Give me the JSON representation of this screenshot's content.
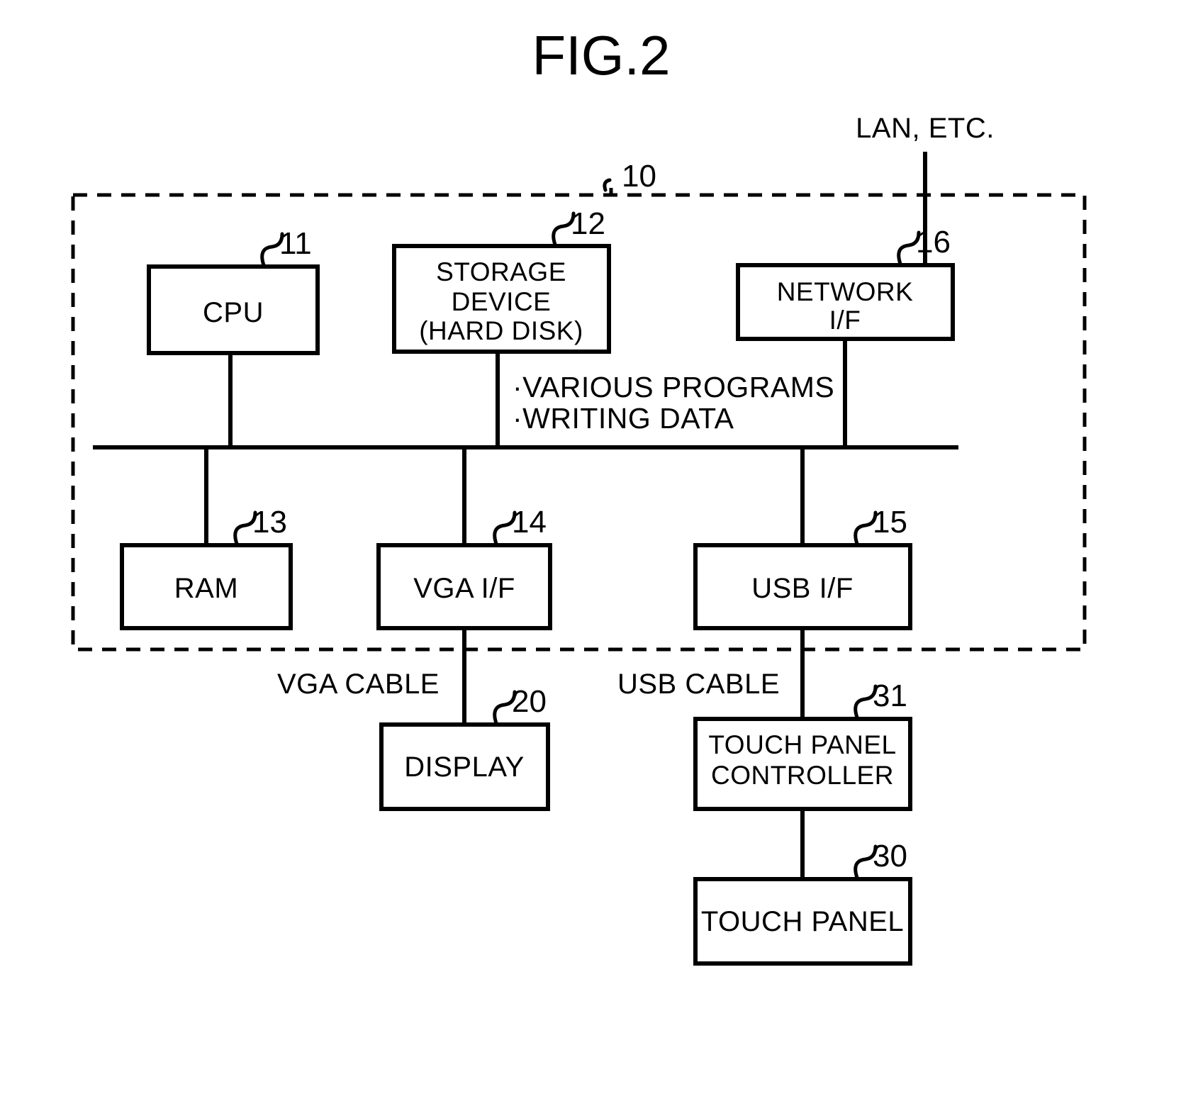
{
  "figure": {
    "title": "FIG.2",
    "external_label": "LAN, ETC."
  },
  "system": {
    "ref": "10"
  },
  "blocks": {
    "cpu": {
      "label": "CPU",
      "ref": "11"
    },
    "storage": {
      "line1": "STORAGE",
      "line2": "DEVICE",
      "line3": "(HARD DISK)",
      "ref": "12"
    },
    "network_if": {
      "line1": "NETWORK",
      "line2": "I/F",
      "ref": "16"
    },
    "ram": {
      "label": "RAM",
      "ref": "13"
    },
    "vga_if": {
      "label": "VGA I/F",
      "ref": "14"
    },
    "usb_if": {
      "label": "USB I/F",
      "ref": "15"
    },
    "display": {
      "label": "DISPLAY",
      "ref": "20"
    },
    "tp_ctrl": {
      "line1": "TOUCH PANEL",
      "line2": "CONTROLLER",
      "ref": "31"
    },
    "touch_panel": {
      "label": "TOUCH PANEL",
      "ref": "30"
    }
  },
  "annotations": {
    "bus_note_line1": "·VARIOUS PROGRAMS",
    "bus_note_line2": "·WRITING DATA",
    "vga_cable": "VGA CABLE",
    "usb_cable": "USB CABLE"
  }
}
